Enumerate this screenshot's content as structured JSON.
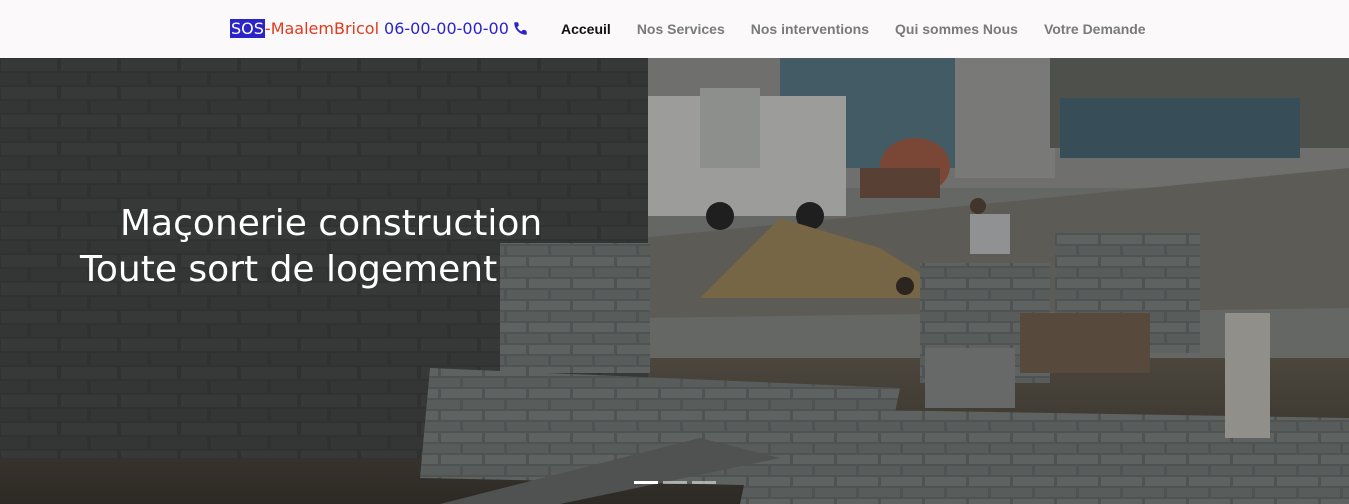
{
  "brand": {
    "sos": "SOS",
    "dash": "-",
    "name": "MaalemBricol",
    "phone": "06-00-00-00-00",
    "phone_icon": "phone-icon",
    "colors": {
      "sos_bg": "#2b24c9",
      "name": "#e03a1e",
      "phone": "#2b24c9"
    }
  },
  "nav": {
    "items": [
      {
        "label": "Acceuil",
        "active": true
      },
      {
        "label": "Nos Services",
        "active": false
      },
      {
        "label": "Nos interventions",
        "active": false
      },
      {
        "label": "Qui sommes Nous",
        "active": false
      },
      {
        "label": "Votre Demande",
        "active": false
      }
    ]
  },
  "hero": {
    "caption_line1": "Maçonerie construction",
    "caption_line2": "Toute sort de logement",
    "slides": 3,
    "active_slide": 1
  }
}
